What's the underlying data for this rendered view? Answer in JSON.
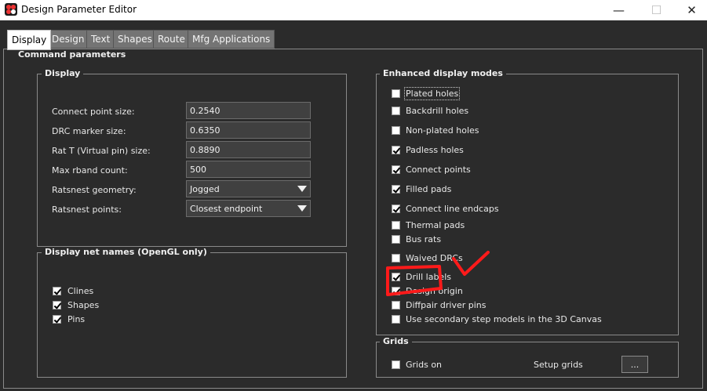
{
  "window": {
    "title": "Design Parameter Editor",
    "minimize_glyph": "—",
    "maximize_glyph": "☐",
    "close_glyph": "✕"
  },
  "tabs": [
    "Display",
    "Design",
    "Text",
    "Shapes",
    "Route",
    "Mfg Applications"
  ],
  "command_parameters": {
    "title": "Command parameters",
    "display": {
      "title": "Display",
      "fields": [
        {
          "label": "Connect point size:",
          "value": "0.2540",
          "type": "text"
        },
        {
          "label": "DRC marker size:",
          "value": "0.6350",
          "type": "text"
        },
        {
          "label": "Rat T (Virtual pin) size:",
          "value": "0.8890",
          "type": "text"
        },
        {
          "label": "Max rband count:",
          "value": "500",
          "type": "text"
        },
        {
          "label": "Ratsnest geometry:",
          "value": "Jogged",
          "type": "select"
        },
        {
          "label": "Ratsnest points:",
          "value": "Closest endpoint",
          "type": "select"
        }
      ]
    },
    "net_names": {
      "title": "Display net names (OpenGL only)",
      "items": [
        {
          "label": "Clines",
          "checked": true
        },
        {
          "label": "Shapes",
          "checked": true
        },
        {
          "label": "Pins",
          "checked": true
        }
      ]
    },
    "enhanced": {
      "title": "Enhanced display modes",
      "items": [
        {
          "label": "Plated holes",
          "checked": false
        },
        {
          "label": "Backdrill holes",
          "checked": false
        },
        {
          "label": "Non-plated holes",
          "checked": false
        },
        {
          "label": "Padless holes",
          "checked": true
        },
        {
          "label": "Connect points",
          "checked": true
        },
        {
          "label": "Filled pads",
          "checked": true
        },
        {
          "label": "Connect line endcaps",
          "checked": true
        },
        {
          "label": "Thermal pads",
          "checked": false
        },
        {
          "label": "Bus rats",
          "checked": false
        },
        {
          "label": "Waived DRCs",
          "checked": false
        },
        {
          "label": "Drill labels",
          "checked": true
        },
        {
          "label": "Design origin",
          "checked": true
        },
        {
          "label": "Diffpair driver pins",
          "checked": false
        },
        {
          "label": "Use secondary step models in the 3D Canvas",
          "checked": false
        }
      ]
    },
    "grids": {
      "title": "Grids",
      "grids_on_label": "Grids on",
      "grids_on_checked": false,
      "setup_label": "Setup grids",
      "setup_button": "..."
    }
  },
  "colors": {
    "background": "#2b2b2b",
    "annotation": "#ff1a1a"
  }
}
